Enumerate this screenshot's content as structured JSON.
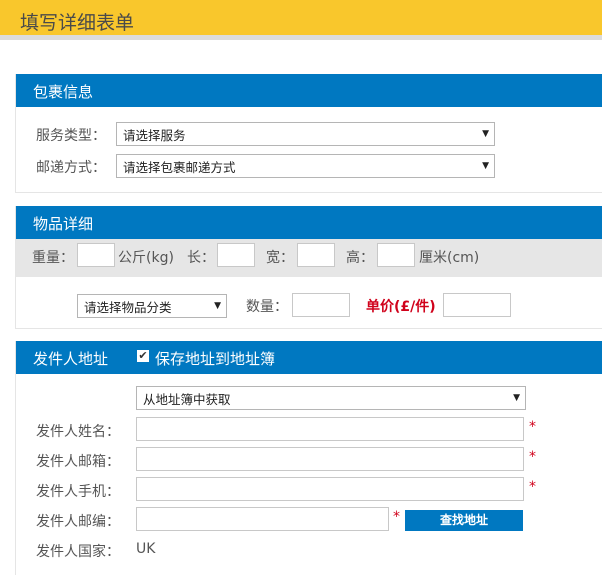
{
  "page": {
    "title": "填写详细表单"
  },
  "package_info": {
    "title": "包裹信息",
    "service_type_label": "服务类型：",
    "service_type_value": "请选择服务",
    "delivery_method_label": "邮递方式：",
    "delivery_method_value": "请选择包裹邮递方式"
  },
  "item_details": {
    "title": "物品详细",
    "weight_label": "重量：",
    "weight_unit": "公斤(kg)",
    "length_label": "长：",
    "width_label": "宽：",
    "height_label": "高：",
    "dimension_unit": "厘米(cm)",
    "category_value": "请选择物品分类",
    "quantity_label": "数量：",
    "unit_price_label": "单价(£/件)"
  },
  "sender": {
    "title": "发件人地址",
    "save_to_book_label": "保存地址到地址簿",
    "save_to_book_checked": true,
    "address_book_value": "从地址簿中获取",
    "name_label": "发件人姓名：",
    "email_label": "发件人邮箱：",
    "phone_label": "发件人手机：",
    "postcode_label": "发件人邮编：",
    "country_label": "发件人国家：",
    "country_value": "UK",
    "find_address_button": "查找地址",
    "required_mark": "*"
  },
  "icons": {
    "dropdown": "▼",
    "checkmark": "✔"
  },
  "colors": {
    "header": "#f9c72c",
    "section": "#0078c1",
    "required": "#d0021b"
  }
}
